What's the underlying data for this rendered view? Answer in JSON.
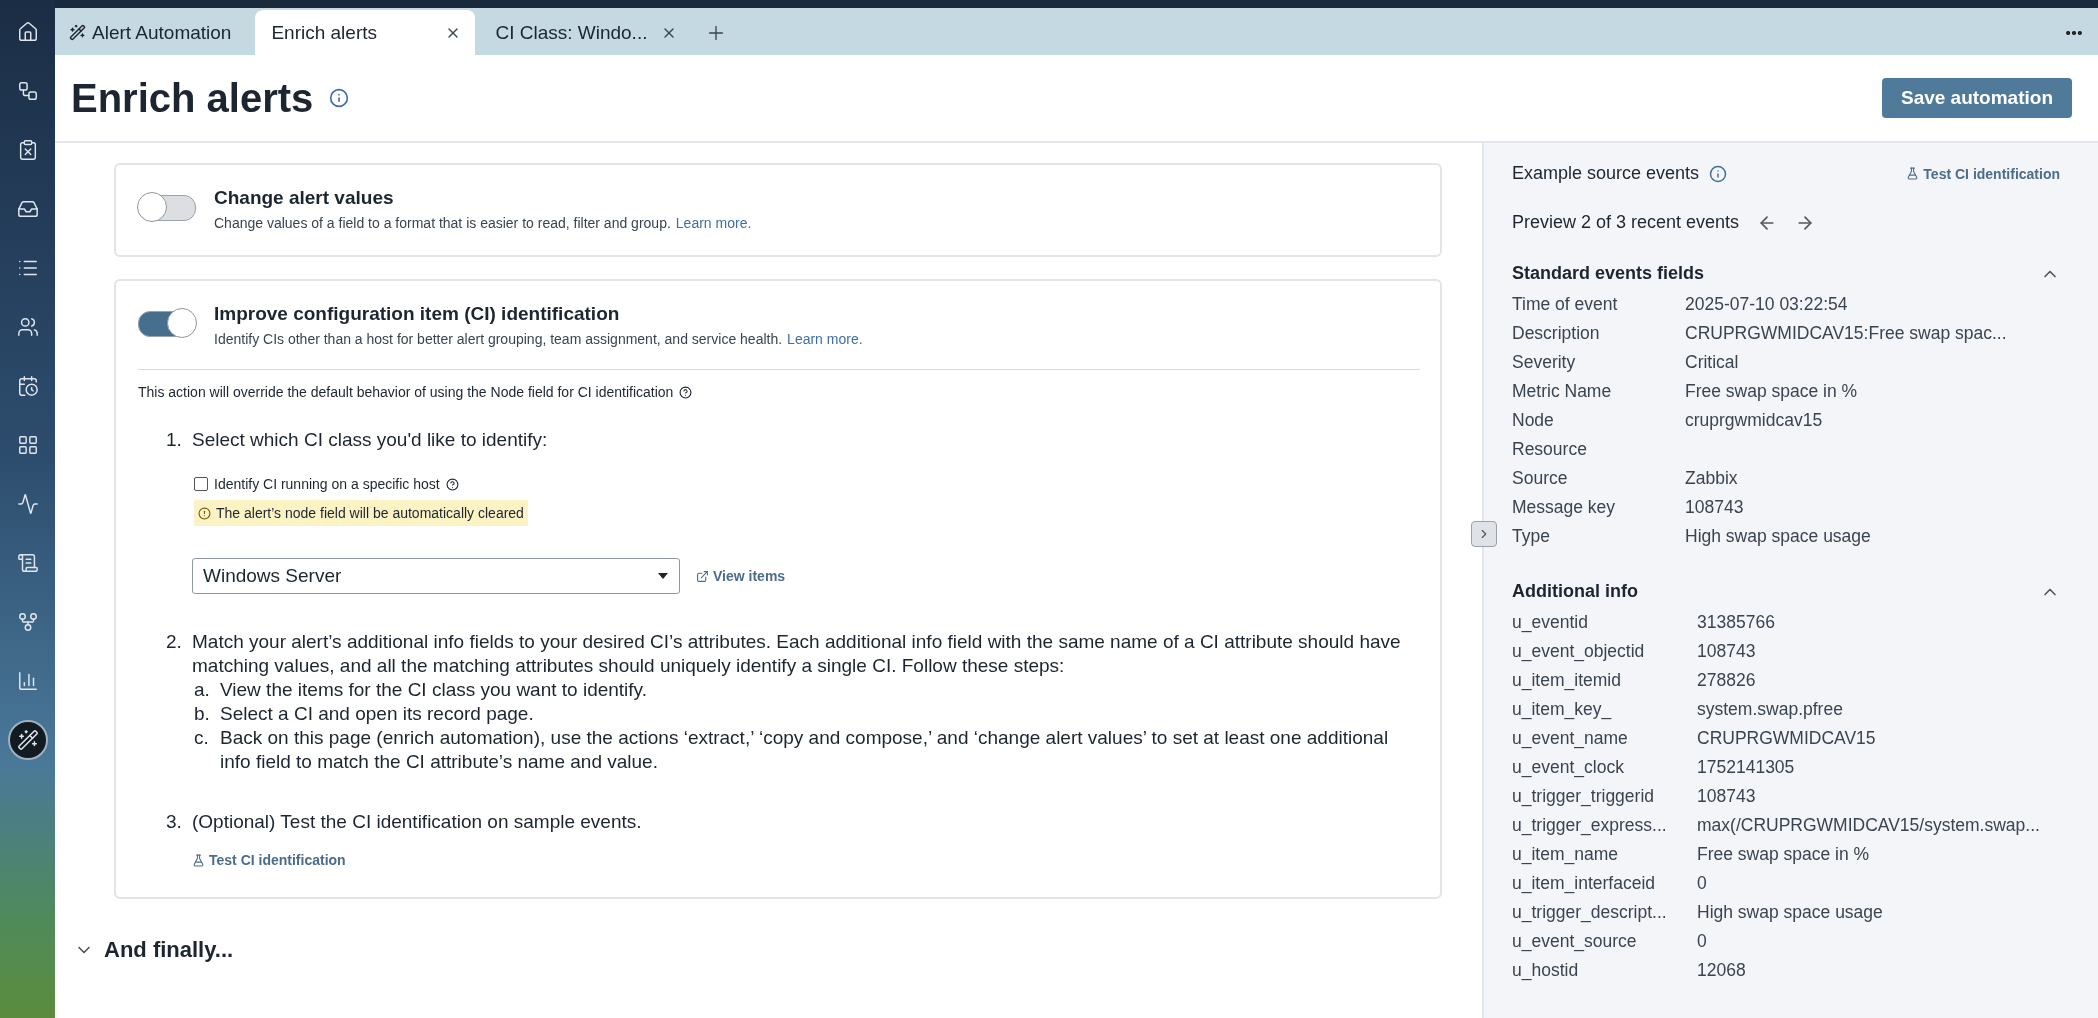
{
  "sidebar": {
    "items": [
      {
        "selected": false
      },
      {
        "selected": false
      },
      {
        "selected": false
      },
      {
        "selected": false
      },
      {
        "selected": false
      },
      {
        "selected": false
      },
      {
        "selected": false
      },
      {
        "selected": false
      },
      {
        "selected": false
      },
      {
        "selected": false
      },
      {
        "selected": false
      },
      {
        "selected": false
      },
      {
        "selected": true
      }
    ]
  },
  "tabs": [
    {
      "label": "Alert Automation",
      "kind": "wand",
      "closable": false,
      "selected": false
    },
    {
      "label": "Enrich alerts",
      "kind": "plain",
      "closable": true,
      "selected": true
    },
    {
      "label": "CI Class: Windo...",
      "kind": "plain",
      "closable": true,
      "selected": false
    }
  ],
  "header": {
    "title": "Enrich alerts",
    "button": "Save automation"
  },
  "cards": [
    {
      "title": "Change alert values",
      "description": "Change values of a field to a format that is easier to read, filter and group.",
      "link": "Learn more.",
      "on": false
    },
    {
      "title": "Improve configuration item (CI) identification",
      "description": "Identify CIs other than a host for better alert grouping, team assignment, and service health.",
      "link": "Learn more.",
      "on": true,
      "note": "This action will override the default behavior of using the Node field for CI identification",
      "steps": [
        {
          "kind": "select",
          "number": "1.",
          "text": "Select which CI class you'd like to identify:",
          "checkbox": {
            "label": "Identify CI running on a specific host",
            "checked": false
          },
          "warning": "The alert’s node field will be automatically cleared",
          "select_value": "Windows Server",
          "link": "View items"
        },
        {
          "kind": "list",
          "number": "2.",
          "text": "Match your alert’s additional info fields to your desired CI’s attributes. Each additional info field with the same name of a CI attribute should have matching values, and all the matching attributes should uniquely identify a single CI. Follow these steps:",
          "substeps": [
            {
              "letter": "a.",
              "text": "View the items for the CI class you want to identify."
            },
            {
              "letter": "b.",
              "text": "Select a CI and open its record page."
            },
            {
              "letter": "c.",
              "text": "Back on this page (enrich automation), use the actions ‘extract,’ ‘copy and compose,’ and ‘change alert values’ to set at least one additional info field to match the CI attribute’s name and value."
            }
          ]
        },
        {
          "kind": "test",
          "number": "3.",
          "text": "(Optional) Test the CI identification on sample events.",
          "link": "Test CI identification"
        }
      ]
    }
  ],
  "final_section": {
    "title": "And finally..."
  },
  "events_panel": {
    "title": "Example source events",
    "test_link": "Test CI identification",
    "preview": "Preview 2 of 3 recent events",
    "sections": [
      {
        "title": "Standard events fields",
        "expanded": true,
        "fields": [
          {
            "label": "Time of event",
            "value": "2025-07-10 03:22:54"
          },
          {
            "label": "Description",
            "value": "CRUPRGWMIDCAV15:Free swap spac..."
          },
          {
            "label": "Severity",
            "value": "Critical"
          },
          {
            "label": "Metric Name",
            "value": "Free swap space in %"
          },
          {
            "label": "Node",
            "value": "cruprgwmidcav15"
          },
          {
            "label": "Resource"
          },
          {
            "label": "Source",
            "value": "Zabbix"
          },
          {
            "label": "Message key",
            "value": "108743"
          },
          {
            "label": "Type",
            "value": "High swap space usage"
          }
        ]
      },
      {
        "title": "Additional info",
        "expanded": true,
        "fields": [
          {
            "label": "u_eventid",
            "value": "31385766"
          },
          {
            "label": "u_event_objectid",
            "value": "108743"
          },
          {
            "label": "u_item_itemid",
            "value": "278826"
          },
          {
            "label": "u_item_key_",
            "value": "system.swap.pfree"
          },
          {
            "label": "u_event_name",
            "value": "CRUPRGWMIDCAV15"
          },
          {
            "label": "u_event_clock",
            "value": "1752141305"
          },
          {
            "label": "u_trigger_triggerid",
            "value": "108743"
          },
          {
            "label": "u_trigger_express...",
            "value": "max(/CRUPRGWMIDCAV15/system.swap..."
          },
          {
            "label": "u_item_name",
            "value": "Free swap space in %"
          },
          {
            "label": "u_item_interfaceid",
            "value": "0"
          },
          {
            "label": "u_trigger_descript...",
            "value": "High swap space usage"
          },
          {
            "label": "u_event_source",
            "value": "0"
          },
          {
            "label": "u_hostid",
            "value": "12068"
          }
        ]
      }
    ]
  }
}
